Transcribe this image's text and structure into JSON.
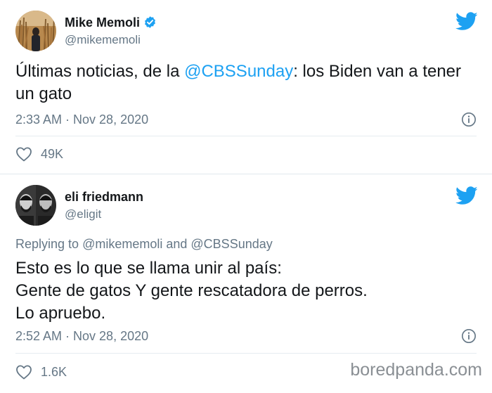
{
  "tweet1": {
    "author_name": "Mike Memoli",
    "author_handle": "@mikememoli",
    "text_before": "Últimas noticias, de la ",
    "mention": "@CBSSunday",
    "text_after": ": los Biden van a tener un gato",
    "timestamp": "2:33 AM · Nov 28, 2020",
    "likes": "49K",
    "icons": [
      "verified-badge-icon",
      "twitter-bird-icon",
      "info-icon",
      "heart-icon"
    ]
  },
  "tweet2": {
    "author_name": "eli friedmann",
    "author_handle": "@eligit",
    "replying_label": "Replying to ",
    "replying_to_1": "@mikememoli",
    "replying_and": " and ",
    "replying_to_2": "@CBSSunday",
    "text_lines": [
      "Esto es lo que se llama unir al país:",
      "Gente de gatos Y gente rescatadora de perros.",
      "Lo apruebo."
    ],
    "timestamp": "2:52 AM · Nov 28, 2020",
    "likes": "1.6K"
  },
  "watermark": "boredpanda.com",
  "colors": {
    "accent": "#1da1f2",
    "secondary_text": "#657786",
    "primary_text": "#14171a"
  }
}
